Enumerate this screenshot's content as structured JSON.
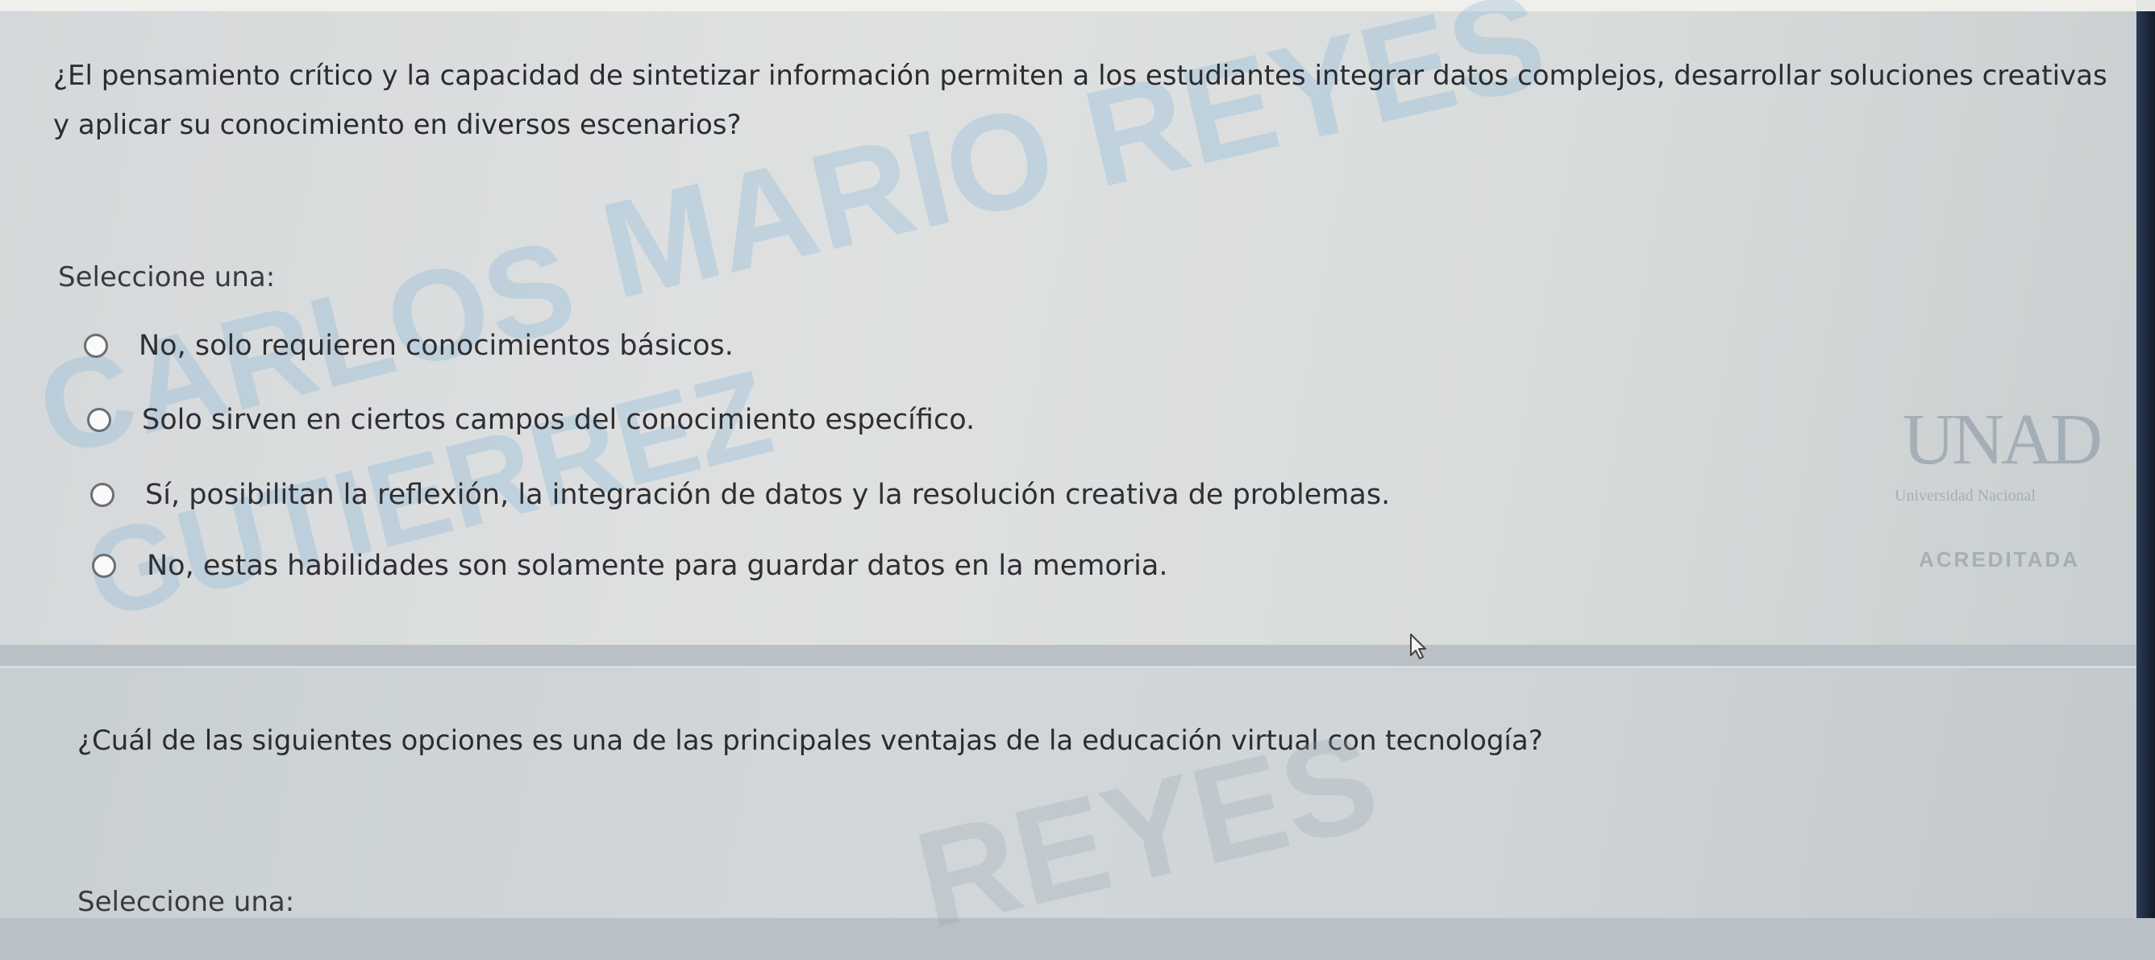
{
  "question1": {
    "text": "¿El pensamiento crítico y la capacidad de sintetizar información permiten a los estudiantes integrar datos complejos, desarrollar soluciones creativas y aplicar su conocimiento en diversos escenarios?",
    "select_label": "Seleccione una:",
    "options": [
      "No, solo requieren conocimientos básicos.",
      "Solo sirven en ciertos campos del conocimiento específico.",
      "Sí, posibilitan la reflexión, la integración de datos y la resolución creativa de problemas.",
      "No, estas habilidades son solamente para guardar datos en la memoria."
    ]
  },
  "question2": {
    "text": "¿Cuál de las siguientes opciones es una de las principales ventajas de la educación virtual con tecnología?",
    "select_label": "Seleccione una:"
  },
  "watermark": {
    "line1": "MARIO REYES",
    "line2": "CARLOS",
    "line3": "GUTIERREZ",
    "line4": "REYES"
  },
  "seal": {
    "logo": "UNAD",
    "subtitle": "Universidad Nacional",
    "badge": "ACREDITADA"
  },
  "colors": {
    "panel": "#dfe1e1",
    "text": "#2b2b30",
    "watermark": "#78afd7",
    "edge": "#1a2940"
  }
}
